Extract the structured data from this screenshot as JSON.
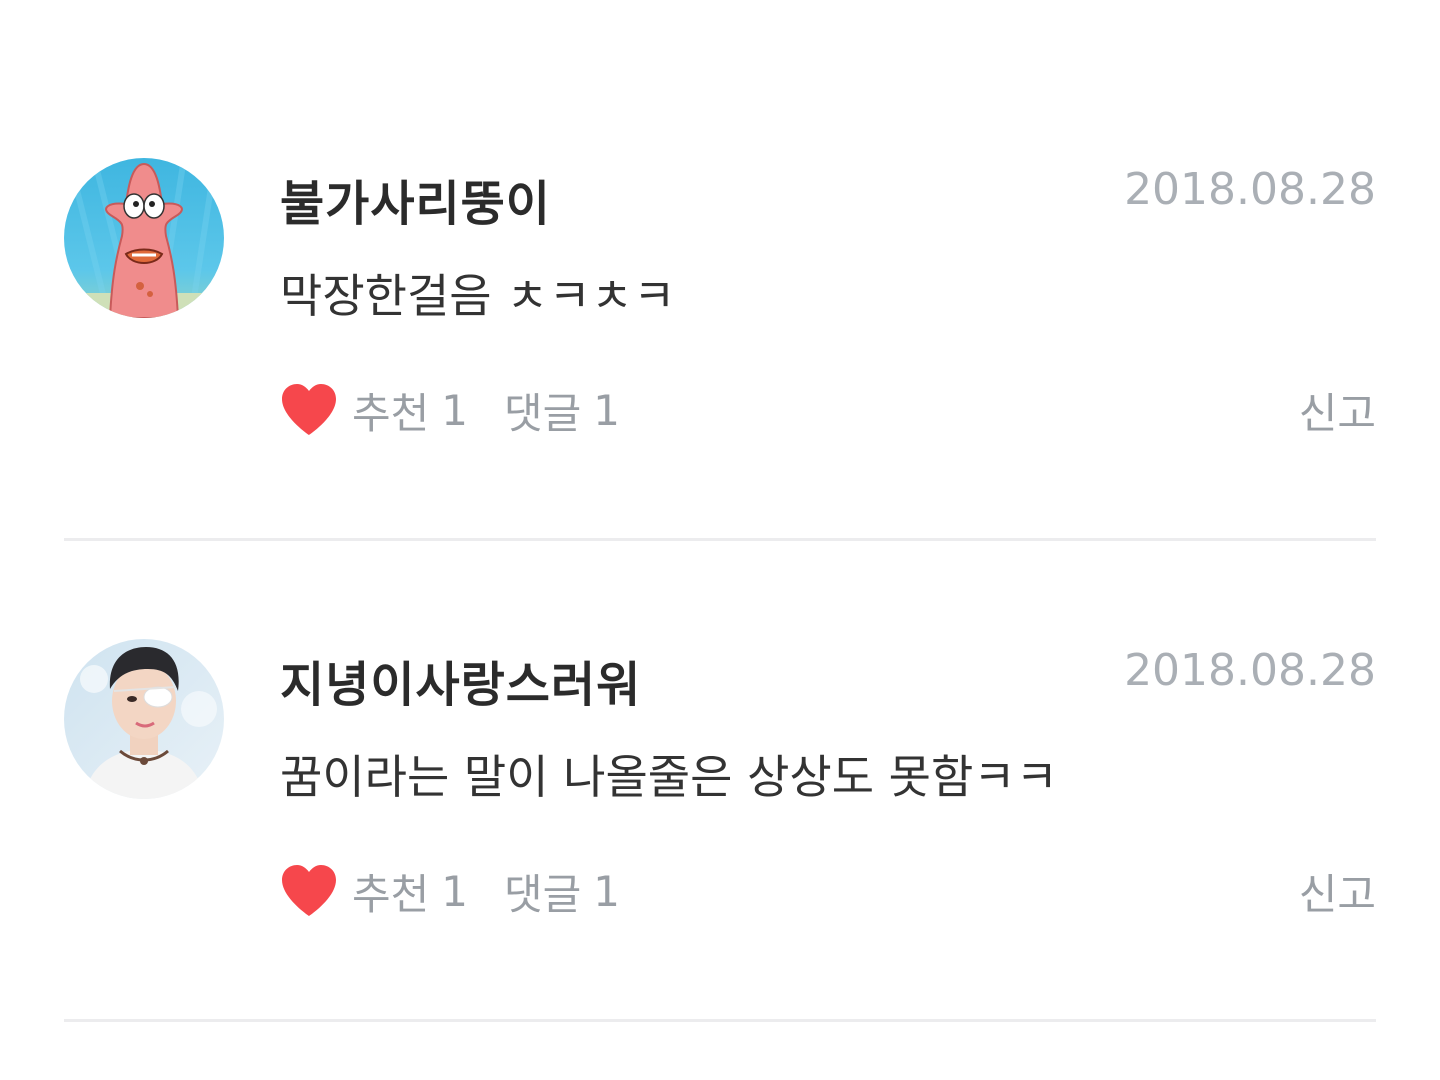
{
  "comments": [
    {
      "nickname": "불가사리뚱이",
      "date": "2018.08.28",
      "text": "막장한걸음 ㅊㅋㅊㅋ",
      "like_label": "추천",
      "like_count": "1",
      "reply_label": "댓글",
      "reply_count": "1",
      "report_label": "신고",
      "avatar_icon": "patrick-star-avatar"
    },
    {
      "nickname": "지녕이사랑스러워",
      "date": "2018.08.28",
      "text": "꿈이라는 말이 나올줄은 상상도 못함ㅋㅋ",
      "like_label": "추천",
      "like_count": "1",
      "reply_label": "댓글",
      "reply_count": "1",
      "report_label": "신고",
      "avatar_icon": "person-photo-avatar"
    }
  ],
  "colors": {
    "heart": "#f6474c",
    "muted_text": "#999ea4",
    "date_text": "#aaafb5",
    "divider": "#ececee"
  }
}
